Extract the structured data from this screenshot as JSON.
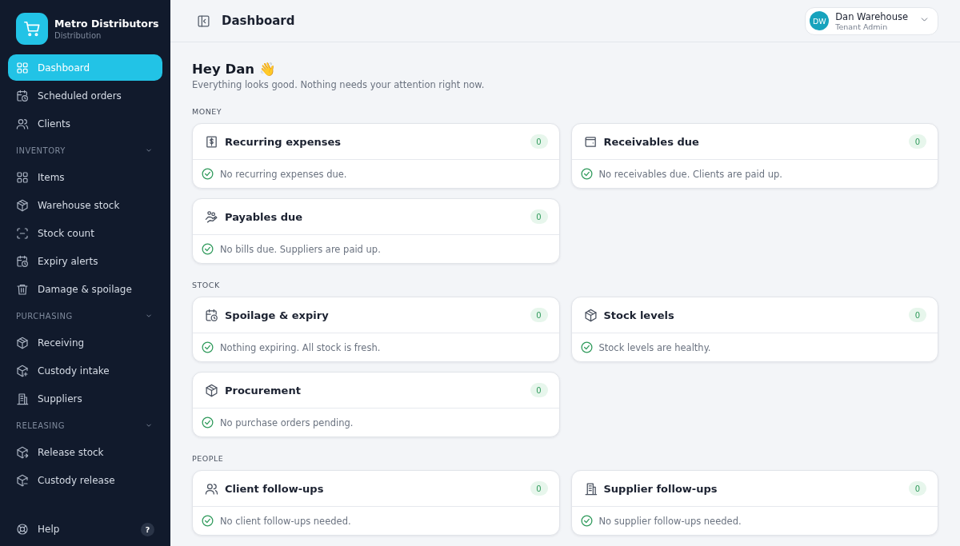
{
  "brand": {
    "name": "Metro Distributors",
    "subtitle": "Distribution"
  },
  "nav": [
    {
      "kind": "item",
      "label": "Dashboard",
      "selected": true
    },
    {
      "kind": "item",
      "label": "Scheduled orders",
      "selected": false
    },
    {
      "kind": "item",
      "label": "Clients",
      "selected": false
    },
    {
      "kind": "section",
      "label": "INVENTORY",
      "expanded": true
    },
    {
      "kind": "item",
      "label": "Items",
      "selected": false
    },
    {
      "kind": "item",
      "label": "Warehouse stock",
      "selected": false
    },
    {
      "kind": "item",
      "label": "Stock count",
      "selected": false
    },
    {
      "kind": "item",
      "label": "Expiry alerts",
      "selected": false
    },
    {
      "kind": "item",
      "label": "Damage & spoilage",
      "selected": false
    },
    {
      "kind": "section",
      "label": "PURCHASING",
      "expanded": true
    },
    {
      "kind": "item",
      "label": "Receiving",
      "selected": false
    },
    {
      "kind": "item",
      "label": "Custody intake",
      "selected": false
    },
    {
      "kind": "item",
      "label": "Suppliers",
      "selected": false
    },
    {
      "kind": "section",
      "label": "RELEASING",
      "expanded": true
    },
    {
      "kind": "item",
      "label": "Release stock",
      "selected": false
    },
    {
      "kind": "item",
      "label": "Custody release",
      "selected": false
    }
  ],
  "help": {
    "label": "Help",
    "badge": "?"
  },
  "header": {
    "title": "Dashboard"
  },
  "user": {
    "initials": "DW",
    "name": "Dan Warehouse",
    "role": "Tenant Admin"
  },
  "greeting": {
    "title": "Hey Dan 👋",
    "subtitle": "Everything looks good. Nothing needs your attention right now."
  },
  "sections": [
    {
      "label": "MONEY",
      "cards": [
        {
          "title": "Recurring expenses",
          "count": "0",
          "message": "No recurring expenses due."
        },
        {
          "title": "Receivables due",
          "count": "0",
          "message": "No receivables due. Clients are paid up."
        },
        {
          "title": "Payables due",
          "count": "0",
          "message": "No bills due. Suppliers are paid up."
        }
      ]
    },
    {
      "label": "STOCK",
      "cards": [
        {
          "title": "Spoilage & expiry",
          "count": "0",
          "message": "Nothing expiring. All stock is fresh."
        },
        {
          "title": "Stock levels",
          "count": "0",
          "message": "Stock levels are healthy."
        },
        {
          "title": "Procurement",
          "count": "0",
          "message": "No purchase orders pending."
        }
      ]
    },
    {
      "label": "PEOPLE",
      "cards": [
        {
          "title": "Client follow-ups",
          "count": "0",
          "message": "No client follow-ups needed."
        },
        {
          "title": "Supplier follow-ups",
          "count": "0",
          "message": "No supplier follow-ups needed."
        }
      ]
    }
  ]
}
